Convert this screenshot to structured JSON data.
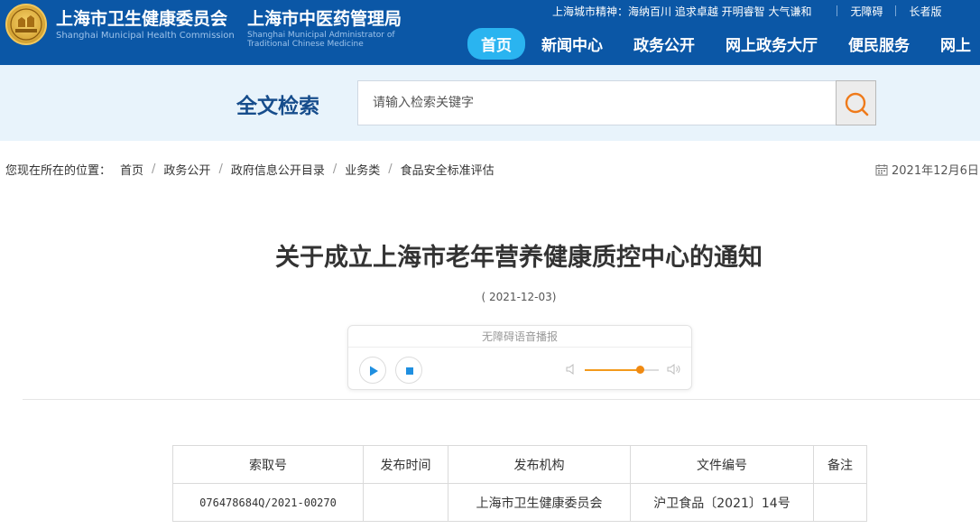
{
  "header": {
    "org1_cn": "上海市卫生健康委员会",
    "org1_en": "Shanghai Municipal Health Commission",
    "org2_cn": "上海市中医药管理局",
    "org2_en": "Shanghai Municipal Administrator of Traditional Chinese Medicine",
    "spirit_text": "上海城市精神：海纳百川 追求卓越 开明睿智 大气谦和",
    "accessibility_link": "无障碍",
    "elder_link": "长者版",
    "nav": [
      "首页",
      "新闻中心",
      "政务公开",
      "网上政务大厅",
      "便民服务",
      "网上"
    ]
  },
  "search": {
    "title": "全文检索",
    "placeholder": "请输入检索关键字"
  },
  "breadcrumb": {
    "label": "您现在所在的位置：",
    "items": [
      "首页",
      "政务公开",
      "政府信息公开目录",
      "业务类",
      "食品安全标准评估"
    ]
  },
  "publish_date_top": "2021年12月6日",
  "document": {
    "title": "关于成立上海市老年营养健康质控中心的通知",
    "date": "( 2021-12-03)"
  },
  "audio": {
    "header": "无障碍语音播报",
    "progress": 0.74
  },
  "info_table": {
    "headers": [
      "索取号",
      "发布时间",
      "发布机构",
      "文件编号",
      "备注"
    ],
    "row": [
      "076478684Q/2021-00270",
      "",
      "上海市卫生健康委员会",
      "沪卫食品〔2021〕14号",
      ""
    ]
  },
  "colors": {
    "header_bg": "#0b57a6",
    "nav_active": "#2ab4f0",
    "search_band": "#e8f3fb",
    "accent_orange": "#f08a12"
  }
}
